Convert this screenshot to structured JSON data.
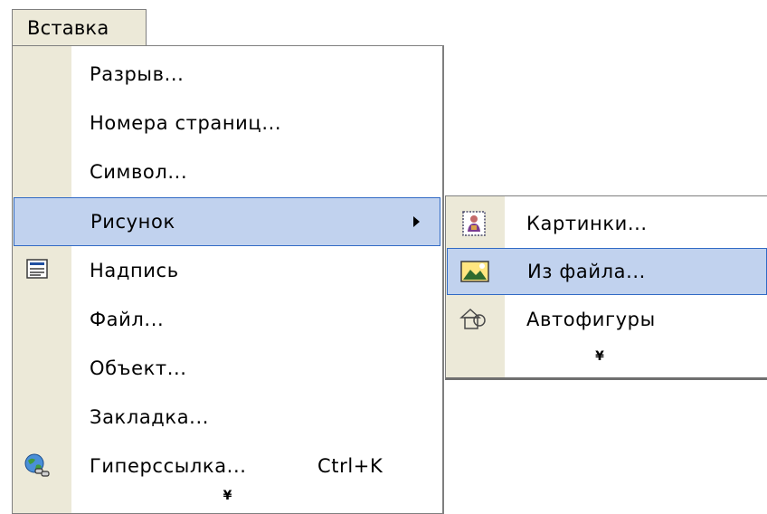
{
  "menubar": {
    "insert_label": "Вставка"
  },
  "menu": {
    "items": [
      {
        "label": "Разрыв..."
      },
      {
        "label": "Номера страниц..."
      },
      {
        "label": "Символ..."
      },
      {
        "label": "Рисунок",
        "has_submenu": true,
        "highlighted": true
      },
      {
        "label": "Надпись",
        "icon": "text-box-icon"
      },
      {
        "label": "Файл..."
      },
      {
        "label": "Объект..."
      },
      {
        "label": "Закладка..."
      },
      {
        "label": "Гиперссылка...",
        "shortcut": "Ctrl+K",
        "icon": "hyperlink-globe-icon"
      }
    ],
    "expand_glyph": "¥"
  },
  "submenu": {
    "items": [
      {
        "label": "Картинки...",
        "icon": "clip-art-icon"
      },
      {
        "label": "Из файла...",
        "icon": "picture-from-file-icon",
        "highlighted": true
      },
      {
        "label": "Автофигуры",
        "icon": "autoshapes-icon"
      }
    ],
    "expand_glyph": "¥"
  },
  "colors": {
    "menu_gutter": "#ece9d8",
    "highlight_fill": "#c1d2ee",
    "highlight_border": "#316ac5",
    "menu_border": "#7f7f7f"
  }
}
